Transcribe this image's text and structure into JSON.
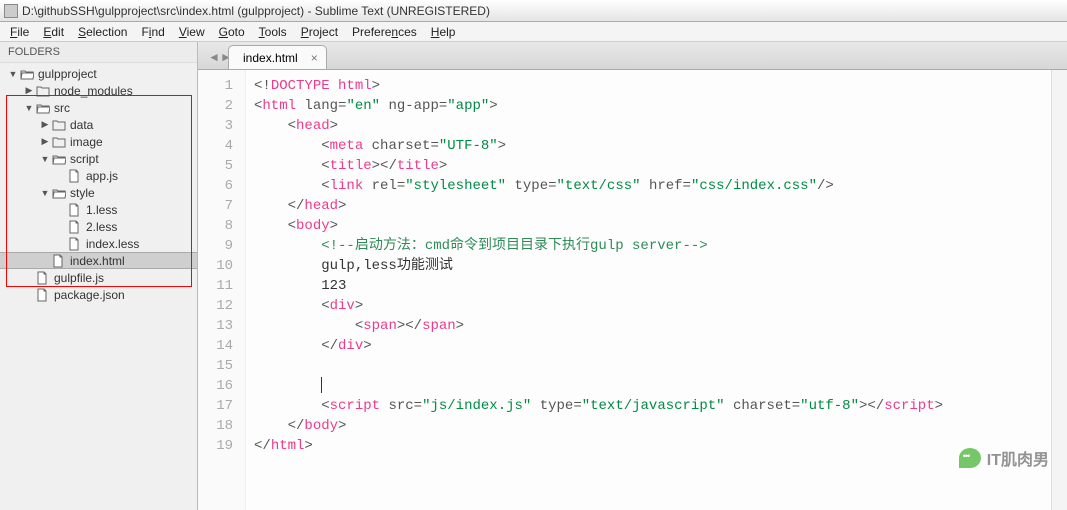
{
  "title": "D:\\githubSSH\\gulpproject\\src\\index.html (gulpproject) - Sublime Text (UNREGISTERED)",
  "menu": [
    "File",
    "Edit",
    "Selection",
    "Find",
    "View",
    "Goto",
    "Tools",
    "Project",
    "Preferences",
    "Help"
  ],
  "sidebar": {
    "header": "FOLDERS",
    "items": [
      {
        "indent": 0,
        "expand": "▼",
        "type": "folder-open",
        "label": "gulpproject"
      },
      {
        "indent": 1,
        "expand": "▶",
        "type": "folder",
        "label": "node_modules"
      },
      {
        "indent": 1,
        "expand": "▼",
        "type": "folder-open",
        "label": "src"
      },
      {
        "indent": 2,
        "expand": "▶",
        "type": "folder",
        "label": "data"
      },
      {
        "indent": 2,
        "expand": "▶",
        "type": "folder",
        "label": "image"
      },
      {
        "indent": 2,
        "expand": "▼",
        "type": "folder-open",
        "label": "script"
      },
      {
        "indent": 3,
        "expand": "",
        "type": "file",
        "label": "app.js"
      },
      {
        "indent": 2,
        "expand": "▼",
        "type": "folder-open",
        "label": "style"
      },
      {
        "indent": 3,
        "expand": "",
        "type": "file",
        "label": "1.less"
      },
      {
        "indent": 3,
        "expand": "",
        "type": "file",
        "label": "2.less"
      },
      {
        "indent": 3,
        "expand": "",
        "type": "file",
        "label": "index.less"
      },
      {
        "indent": 2,
        "expand": "",
        "type": "file",
        "label": "index.html",
        "selected": true
      },
      {
        "indent": 1,
        "expand": "",
        "type": "file",
        "label": "gulpfile.js"
      },
      {
        "indent": 1,
        "expand": "",
        "type": "file",
        "label": "package.json"
      }
    ]
  },
  "tab": {
    "label": "index.html",
    "close": "×"
  },
  "gutter": [
    "1",
    "2",
    "3",
    "4",
    "5",
    "6",
    "7",
    "8",
    "9",
    "10",
    "11",
    "12",
    "13",
    "14",
    "15",
    "16",
    "17",
    "18",
    "19"
  ],
  "code": {
    "l1": "<!DOCTYPE html>",
    "l2a": "html",
    "l2_lang": "lang",
    "l2_langv": "\"en\"",
    "l2_ng": "ng-app",
    "l2_ngv": "\"app\"",
    "l3": "head",
    "l4_meta": "meta",
    "l4_cs": "charset",
    "l4_csv": "\"UTF-8\"",
    "l5": "title",
    "l6_link": "link",
    "l6_rel": "rel",
    "l6_relv": "\"stylesheet\"",
    "l6_type": "type",
    "l6_typev": "\"text/css\"",
    "l6_href": "href",
    "l6_hrefv": "\"css/index.css\"",
    "l7": "head",
    "l8": "body",
    "l9": "<!--启动方法：cmd命令到项目目录下执行gulp server-->",
    "l10": "gulp,less功能测试",
    "l11": "123",
    "l12": "div",
    "l13": "span",
    "l14": "div",
    "l17_sc": "script",
    "l17_src": "src",
    "l17_srcv": "\"js/index.js\"",
    "l17_type": "type",
    "l17_typev": "\"text/javascript\"",
    "l17_cs": "charset",
    "l17_csv": "\"utf-8\"",
    "l18": "body",
    "l19": "html"
  },
  "watermark": "IT肌肉男"
}
